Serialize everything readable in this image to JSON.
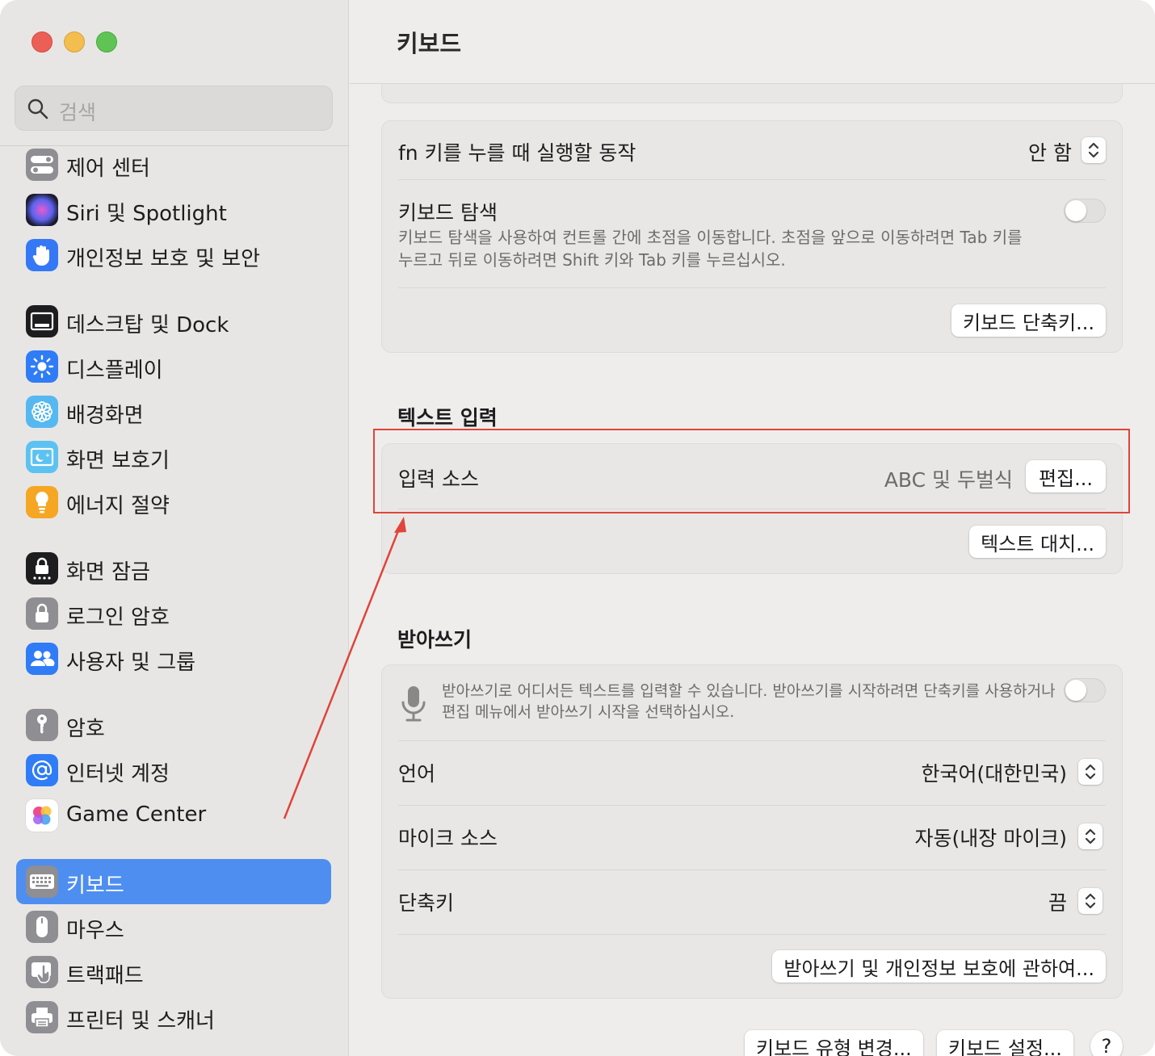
{
  "window": {
    "title": "키보드"
  },
  "search": {
    "placeholder": "검색"
  },
  "sidebar": {
    "items": [
      {
        "label": "제어 센터"
      },
      {
        "label": "Siri 및 Spotlight"
      },
      {
        "label": "개인정보 보호 및 보안"
      },
      {
        "label": "데스크탑 및 Dock"
      },
      {
        "label": "디스플레이"
      },
      {
        "label": "배경화면"
      },
      {
        "label": "화면 보호기"
      },
      {
        "label": "에너지 절약"
      },
      {
        "label": "화면 잠금"
      },
      {
        "label": "로그인 암호"
      },
      {
        "label": "사용자 및 그룹"
      },
      {
        "label": "암호"
      },
      {
        "label": "인터넷 계정"
      },
      {
        "label": "Game Center"
      },
      {
        "label": "키보드",
        "selected": true
      },
      {
        "label": "마우스"
      },
      {
        "label": "트랙패드"
      },
      {
        "label": "프린터 및 스캐너"
      }
    ]
  },
  "keyboard": {
    "fn_label": "fn 키를 누를 때 실행할 동작",
    "fn_value": "안 함",
    "nav_label": "키보드 탐색",
    "nav_desc_line1": "키보드 탐색을 사용하여 컨트롤 간에 초점을 이동합니다. 초점을 앞으로 이동하려면 Tab 키를",
    "nav_desc_line2": "누르고 뒤로 이동하려면 Shift 키와 Tab 키를 누르십시오.",
    "nav_toggle_on": false,
    "shortcuts_button": "키보드 단축키..."
  },
  "text_input": {
    "section_title": "텍스트 입력",
    "input_sources_label": "입력 소스",
    "input_sources_value": "ABC 및 두벌식",
    "edit_button": "편집...",
    "replacements_button": "텍스트 대치..."
  },
  "dictation": {
    "section_title": "받아쓰기",
    "desc_line1": "받아쓰기로 어디서든 텍스트를 입력할 수 있습니다. 받아쓰기를 시작하려면 단축키를 사용하거나",
    "desc_line2": "편집 메뉴에서 받아쓰기 시작을 선택하십시오.",
    "toggle_on": false,
    "language_label": "언어",
    "language_value": "한국어(대한민국)",
    "mic_label": "마이크 소스",
    "mic_value": "자동(내장 마이크)",
    "shortcut_label": "단축키",
    "shortcut_value": "끔",
    "privacy_button": "받아쓰기 및 개인정보 보호에 관하여..."
  },
  "footer": {
    "change_type_button": "키보드 유형 변경...",
    "setup_button": "키보드 설정...",
    "help_button": "?"
  },
  "colors": {
    "accent": "#4e8ef0",
    "annotation": "#e0443a"
  }
}
